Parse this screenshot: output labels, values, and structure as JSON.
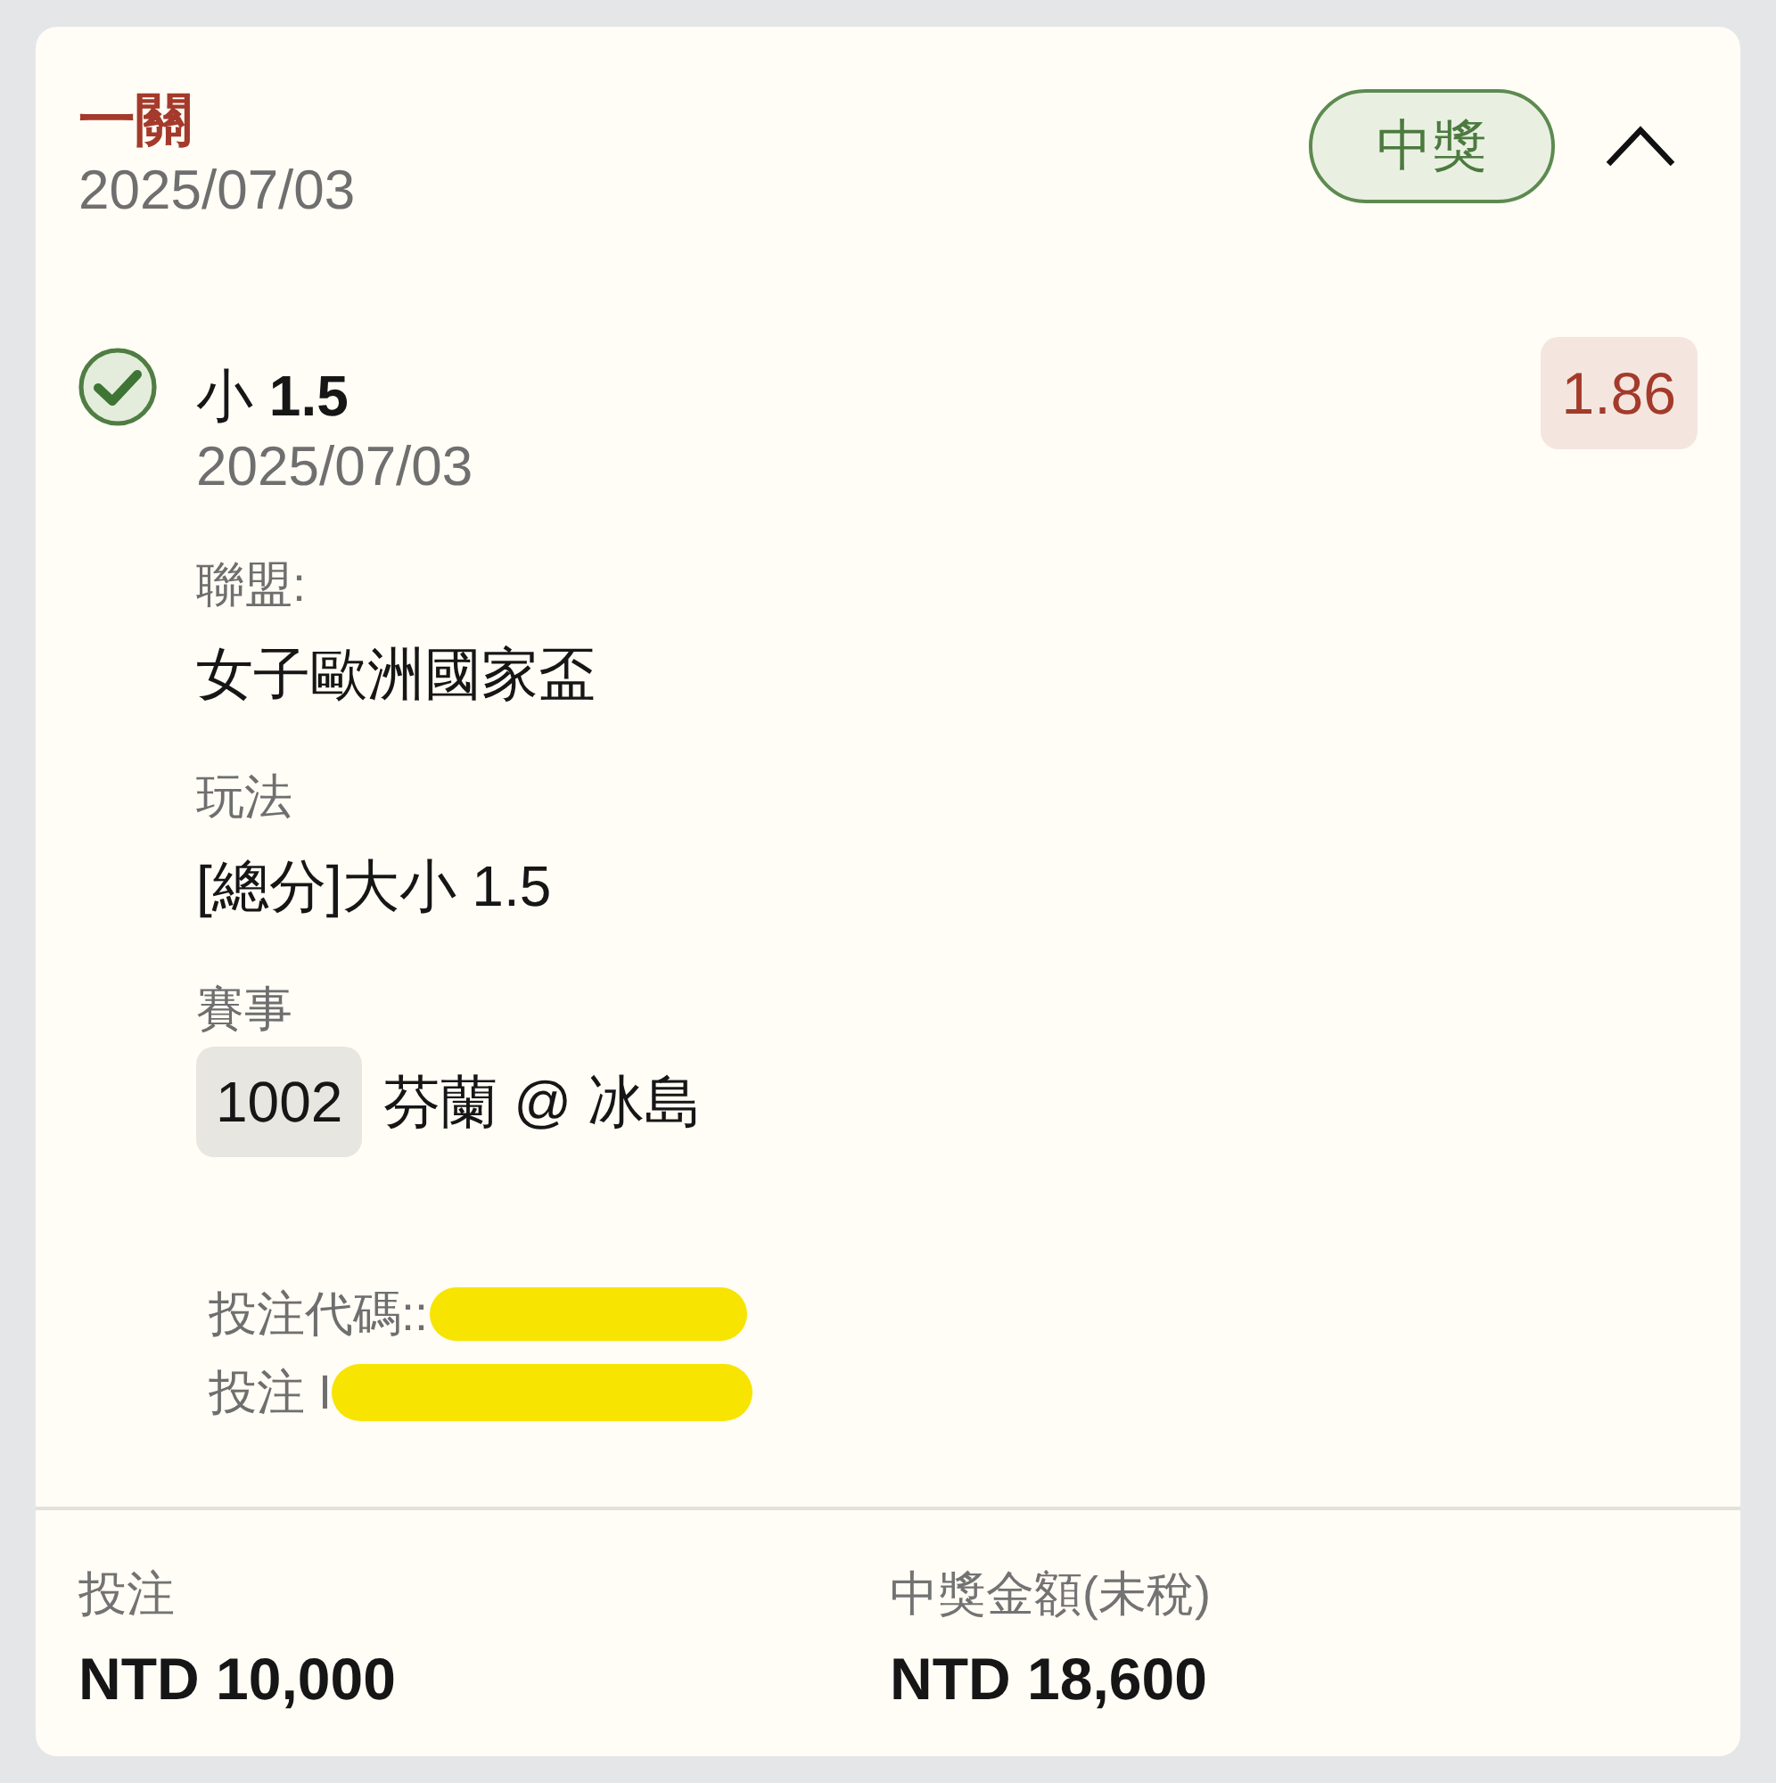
{
  "header": {
    "title": "一關",
    "date": "2025/07/03",
    "status": {
      "kind": "won",
      "label": "中獎"
    },
    "expanded": true
  },
  "selection": {
    "checked": true,
    "pick": "小 **1.5**",
    "date": "2025/07/03",
    "odds": "1.86",
    "fields": [
      {
        "kind": "text",
        "label": "聯盟:",
        "value": "女子歐洲國家盃"
      },
      {
        "kind": "text",
        "label": "玩法",
        "value": "[總分]大小 1.5"
      },
      {
        "kind": "match",
        "label": "賽事",
        "match_number": "1002",
        "value": "芬蘭 @ 冰島"
      }
    ],
    "references": [
      {
        "text": "投注代碼::",
        "redacted": true
      },
      {
        "text": "投注 I",
        "redacted": true
      }
    ]
  },
  "footer": [
    {
      "label": "投注",
      "value": "NTD 10,000"
    },
    {
      "label": "中獎金額(未稅)",
      "value": "NTD 18,600"
    }
  ]
}
